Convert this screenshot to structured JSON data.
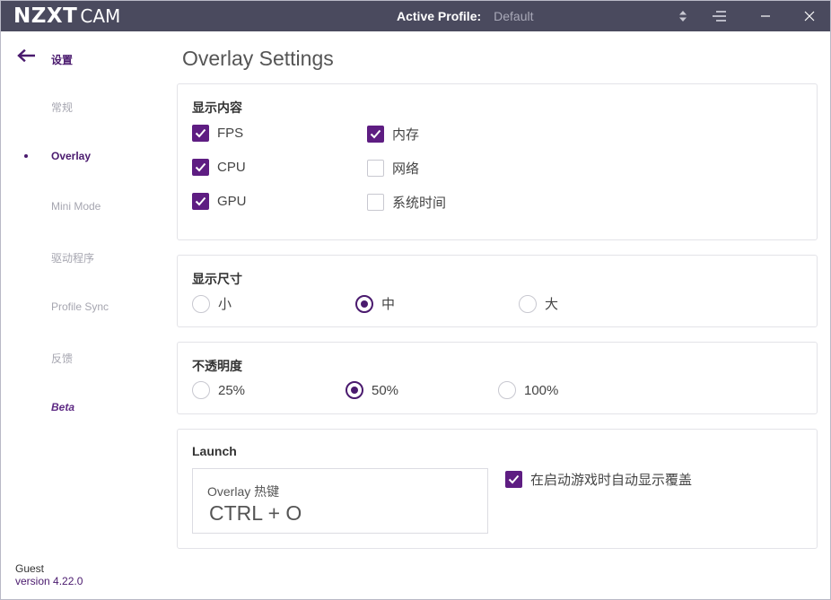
{
  "titlebar": {
    "logo_main": "NZXT",
    "logo_sub": "CAM",
    "profile_label": "Active Profile:",
    "profile_value": "Default"
  },
  "sidebar": {
    "back_label": "设置",
    "items": [
      {
        "label": "常规",
        "active": false
      },
      {
        "label": "Overlay",
        "active": true
      },
      {
        "label": "Mini Mode",
        "active": false
      },
      {
        "label": "驱动程序",
        "active": false
      },
      {
        "label": "Profile Sync",
        "active": false
      },
      {
        "label": "反馈",
        "active": false
      },
      {
        "label": "Beta",
        "active": false
      }
    ],
    "footer_user": "Guest",
    "footer_version": "version 4.22.0"
  },
  "main": {
    "title": "Overlay Settings",
    "display_content": {
      "title": "显示内容",
      "options": [
        {
          "label": "FPS",
          "checked": true
        },
        {
          "label": "CPU",
          "checked": true
        },
        {
          "label": "GPU",
          "checked": true
        },
        {
          "label": "内存",
          "checked": true
        },
        {
          "label": "网络",
          "checked": false
        },
        {
          "label": "系统时间",
          "checked": false
        }
      ]
    },
    "display_size": {
      "title": "显示尺寸",
      "options": [
        "小",
        "中",
        "大"
      ],
      "selected": "中"
    },
    "opacity": {
      "title": "不透明度",
      "options": [
        "25%",
        "50%",
        "100%"
      ],
      "selected": "50%"
    },
    "launch": {
      "title": "Launch",
      "hotkey_label": "Overlay 热键",
      "hotkey_value": "CTRL + O",
      "auto_show_label": "在启动游戏时自动显示覆盖",
      "auto_show_checked": true
    }
  },
  "colors": {
    "accent": "#5e1d82",
    "titlebar_bg": "#4a4a5e"
  }
}
